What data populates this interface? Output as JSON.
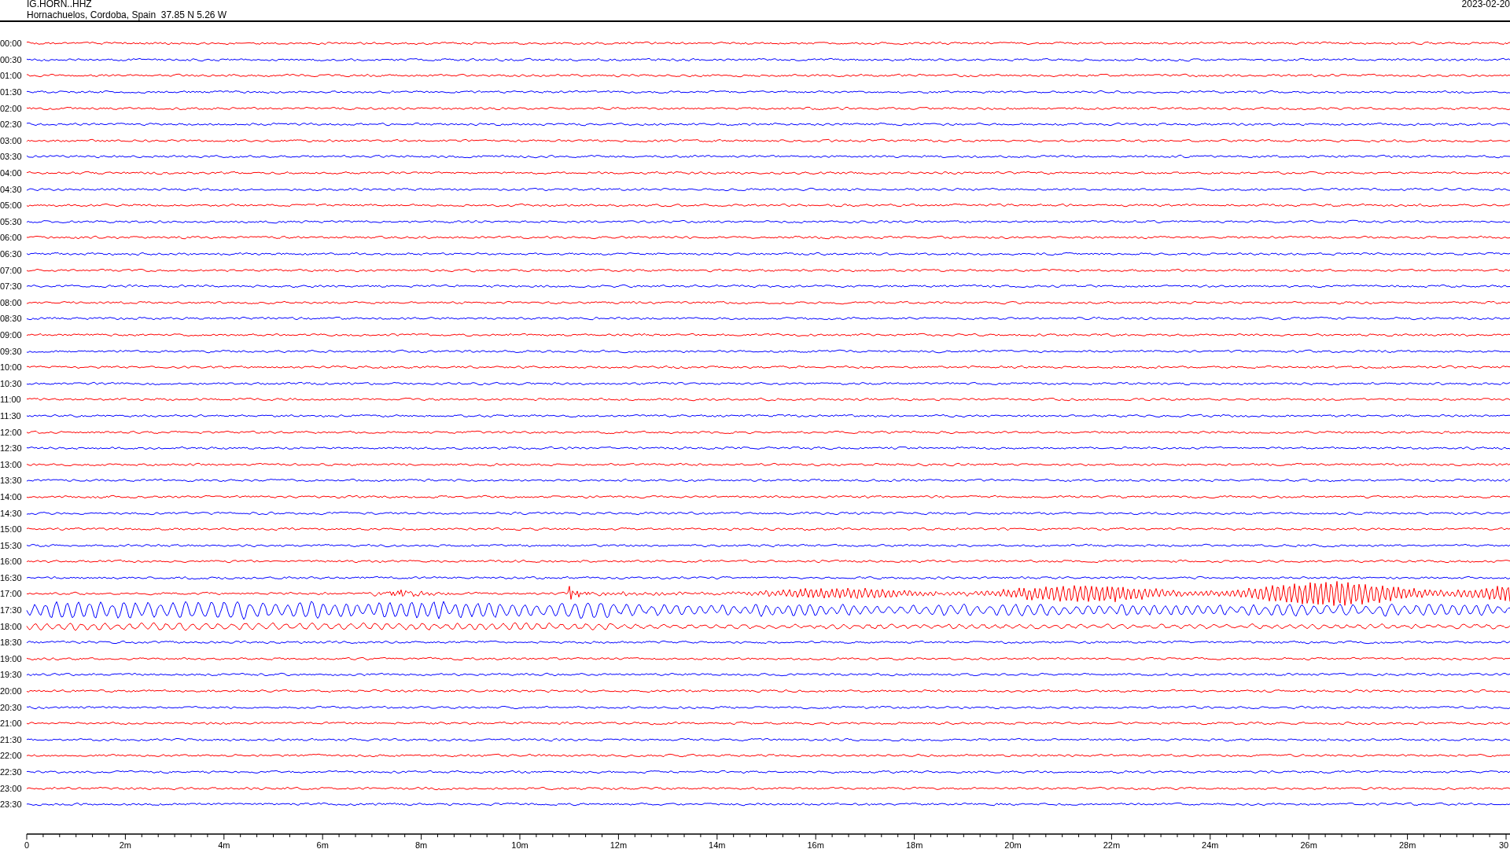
{
  "header": {
    "station": "IG.HORN..HHZ",
    "location": "Hornachuelos, Cordoba, Spain  37.85 N 5.26 W",
    "date": "2023-02-20"
  },
  "rows": [
    {
      "time": "00:00",
      "color": "#ff0000"
    },
    {
      "time": "00:30",
      "color": "#0000ff"
    },
    {
      "time": "01:00",
      "color": "#ff0000"
    },
    {
      "time": "01:30",
      "color": "#0000ff"
    },
    {
      "time": "02:00",
      "color": "#ff0000"
    },
    {
      "time": "02:30",
      "color": "#0000ff"
    },
    {
      "time": "03:00",
      "color": "#ff0000"
    },
    {
      "time": "03:30",
      "color": "#0000ff"
    },
    {
      "time": "04:00",
      "color": "#ff0000"
    },
    {
      "time": "04:30",
      "color": "#0000ff"
    },
    {
      "time": "05:00",
      "color": "#ff0000"
    },
    {
      "time": "05:30",
      "color": "#0000ff"
    },
    {
      "time": "06:00",
      "color": "#ff0000"
    },
    {
      "time": "06:30",
      "color": "#0000ff"
    },
    {
      "time": "07:00",
      "color": "#ff0000"
    },
    {
      "time": "07:30",
      "color": "#0000ff"
    },
    {
      "time": "08:00",
      "color": "#ff0000"
    },
    {
      "time": "08:30",
      "color": "#0000ff"
    },
    {
      "time": "09:00",
      "color": "#ff0000"
    },
    {
      "time": "09:30",
      "color": "#0000ff"
    },
    {
      "time": "10:00",
      "color": "#ff0000"
    },
    {
      "time": "10:30",
      "color": "#0000ff"
    },
    {
      "time": "11:00",
      "color": "#ff0000"
    },
    {
      "time": "11:30",
      "color": "#0000ff"
    },
    {
      "time": "12:00",
      "color": "#ff0000"
    },
    {
      "time": "12:30",
      "color": "#0000ff"
    },
    {
      "time": "13:00",
      "color": "#ff0000"
    },
    {
      "time": "13:30",
      "color": "#0000ff"
    },
    {
      "time": "14:00",
      "color": "#ff0000"
    },
    {
      "time": "14:30",
      "color": "#0000ff"
    },
    {
      "time": "15:00",
      "color": "#ff0000"
    },
    {
      "time": "15:30",
      "color": "#0000ff"
    },
    {
      "time": "16:00",
      "color": "#ff0000"
    },
    {
      "time": "16:30",
      "color": "#0000ff"
    },
    {
      "time": "17:00",
      "color": "#ff0000"
    },
    {
      "time": "17:30",
      "color": "#0000ff"
    },
    {
      "time": "18:00",
      "color": "#ff0000"
    },
    {
      "time": "18:30",
      "color": "#0000ff"
    },
    {
      "time": "19:00",
      "color": "#ff0000"
    },
    {
      "time": "19:30",
      "color": "#0000ff"
    },
    {
      "time": "20:00",
      "color": "#ff0000"
    },
    {
      "time": "20:30",
      "color": "#0000ff"
    },
    {
      "time": "21:00",
      "color": "#ff0000"
    },
    {
      "time": "21:30",
      "color": "#0000ff"
    },
    {
      "time": "22:00",
      "color": "#ff0000"
    },
    {
      "time": "22:30",
      "color": "#0000ff"
    },
    {
      "time": "23:00",
      "color": "#ff0000"
    },
    {
      "time": "23:30",
      "color": "#0000ff"
    }
  ],
  "axis": {
    "labels": [
      "0",
      "2m",
      "4m",
      "6m",
      "8m",
      "10m",
      "12m",
      "14m",
      "16m",
      "18m",
      "20m",
      "22m",
      "24m",
      "26m",
      "28m",
      "30"
    ]
  }
}
